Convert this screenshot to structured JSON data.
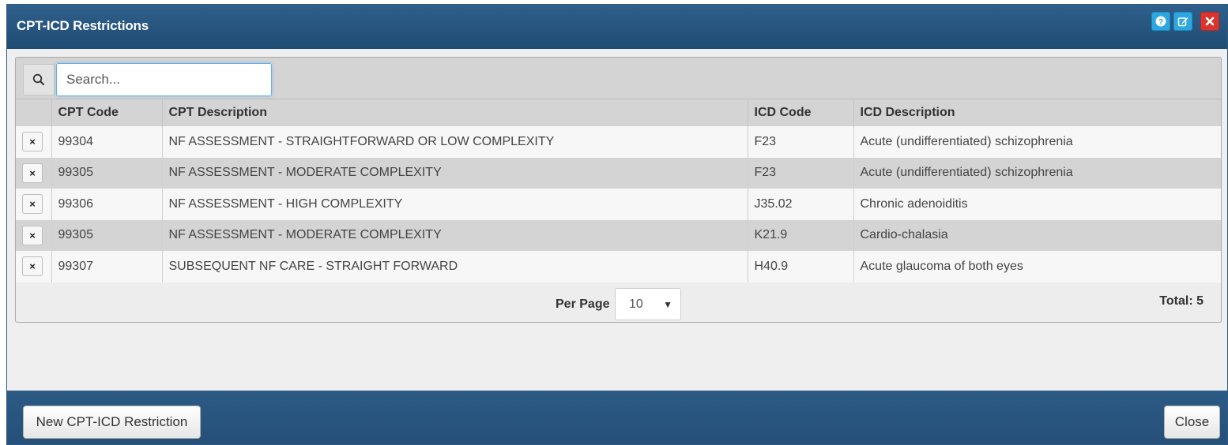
{
  "dialog": {
    "title": "CPT-ICD Restrictions",
    "title_buttons": [
      {
        "name": "help-icon",
        "color": "#2ea7e0"
      },
      {
        "name": "edit-icon",
        "color": "#2ea7e0"
      },
      {
        "name": "close-icon",
        "color": "#d9352e"
      }
    ]
  },
  "search": {
    "placeholder": "Search...",
    "value": ""
  },
  "table": {
    "columns": [
      "",
      "CPT Code",
      "CPT Description",
      "ICD Code",
      "ICD Description"
    ],
    "rows": [
      {
        "cpt_code": "99304",
        "cpt_desc": "NF ASSESSMENT - STRAIGHTFORWARD OR LOW COMPLEXITY",
        "icd_code": "F23",
        "icd_desc": "Acute (undifferentiated) schizophrenia"
      },
      {
        "cpt_code": "99305",
        "cpt_desc": "NF ASSESSMENT - MODERATE COMPLEXITY",
        "icd_code": "F23",
        "icd_desc": "Acute (undifferentiated) schizophrenia"
      },
      {
        "cpt_code": "99306",
        "cpt_desc": "NF ASSESSMENT - HIGH COMPLEXITY",
        "icd_code": "J35.02",
        "icd_desc": "Chronic adenoiditis"
      },
      {
        "cpt_code": "99305",
        "cpt_desc": "NF ASSESSMENT - MODERATE COMPLEXITY",
        "icd_code": "K21.9",
        "icd_desc": "Cardio-chalasia"
      },
      {
        "cpt_code": "99307",
        "cpt_desc": "SUBSEQUENT NF CARE - STRAIGHT FORWARD",
        "icd_code": "H40.9",
        "icd_desc": "Acute glaucoma of both eyes"
      }
    ],
    "delete_glyph": "×"
  },
  "pagination": {
    "per_page_label": "Per Page",
    "per_page_value": "10",
    "total_label": "Total: 5"
  },
  "footer": {
    "new_button": "New CPT-ICD Restriction",
    "close_button": "Close"
  }
}
